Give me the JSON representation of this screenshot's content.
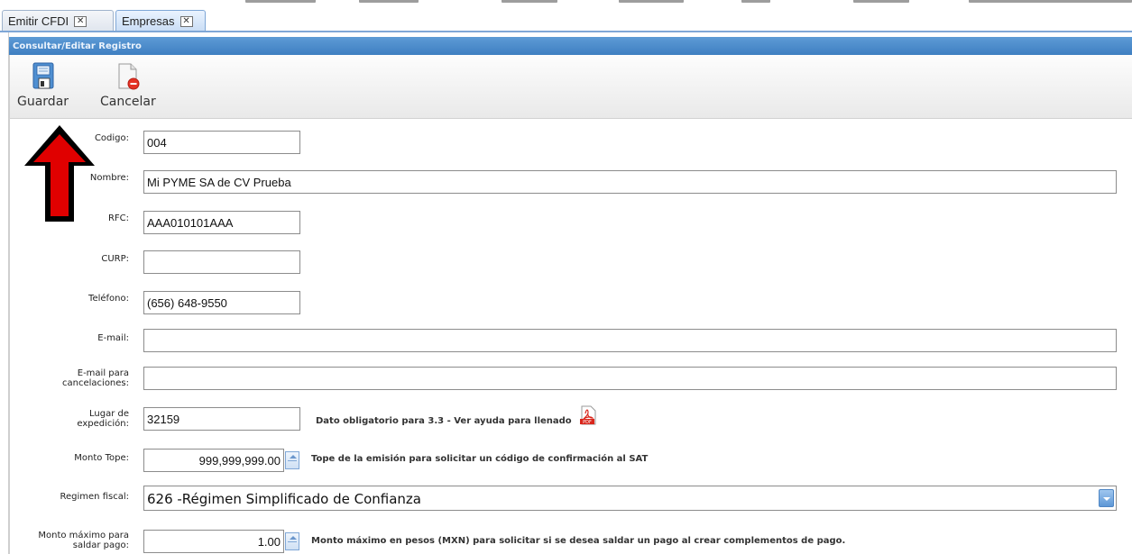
{
  "tabs": [
    {
      "label": "Emitir CFDI",
      "close": "✕"
    },
    {
      "label": "Empresas",
      "close": "✕"
    }
  ],
  "panel": {
    "title": "Consultar/Editar Registro"
  },
  "toolbar": {
    "save_label": "Guardar",
    "cancel_label": "Cancelar"
  },
  "form": {
    "codigo": {
      "label": "Codigo:",
      "value": "004"
    },
    "nombre": {
      "label": "Nombre:",
      "value": "Mi PYME SA de CV Prueba"
    },
    "rfc": {
      "label": "RFC:",
      "value": "AAA010101AAA"
    },
    "curp": {
      "label": "CURP:",
      "value": ""
    },
    "telefono": {
      "label": "Teléfono:",
      "value": "(656) 648-9550"
    },
    "email": {
      "label": "E-mail:",
      "value": ""
    },
    "email_cancel": {
      "label_line1": "E-mail para",
      "label_line2": "cancelaciones:",
      "value": ""
    },
    "lugar": {
      "label_line1": "Lugar de",
      "label_line2": "expedición:",
      "value": "32159",
      "hint": "Dato obligatorio para 3.3 - Ver ayuda para llenado"
    },
    "monto_tope": {
      "label": "Monto Tope:",
      "value": "999,999,999.00",
      "hint": "Tope de la emisión para solicitar un código de confirmación al SAT"
    },
    "regimen": {
      "label": "Regimen fiscal:",
      "value": "626 -Régimen Simplificado de Confianza"
    },
    "monto_max": {
      "label_line1": "Monto máximo para",
      "label_line2": "saldar pago:",
      "value": "1.00",
      "hint": "Monto máximo en pesos (MXN) para solicitar si se desea saldar un pago al crear complementos de pago."
    }
  },
  "colors": {
    "accent": "#3f7fc1",
    "arrow": "#e00000",
    "pdf": "#d9261c"
  }
}
